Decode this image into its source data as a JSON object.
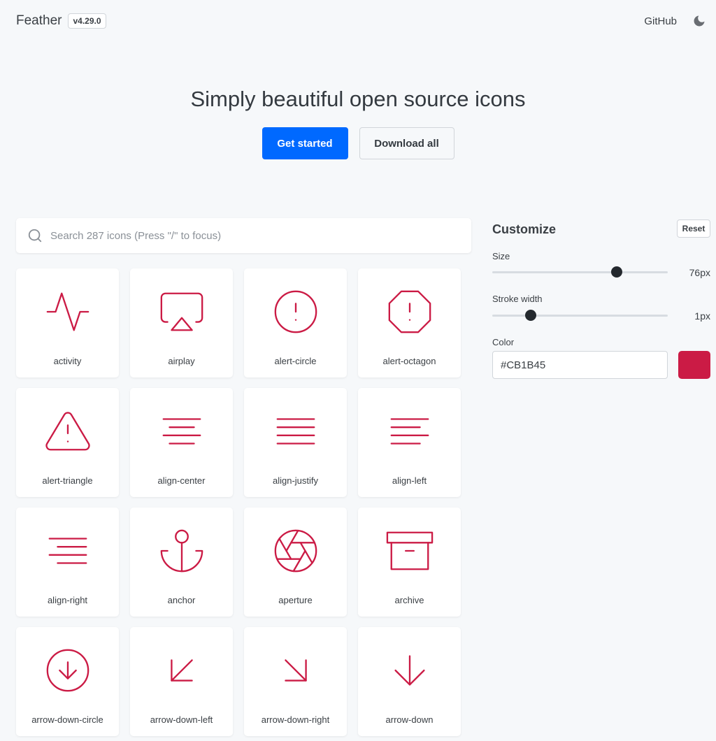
{
  "header": {
    "brand": "Feather",
    "version": "v4.29.0",
    "github_label": "GitHub",
    "theme_icon": "moon-icon"
  },
  "hero": {
    "title": "Simply beautiful open source icons",
    "primary_label": "Get started",
    "secondary_label": "Download all"
  },
  "search": {
    "placeholder": "Search 287 icons (Press \"/\" to focus)",
    "value": ""
  },
  "icons": [
    {
      "name": "activity"
    },
    {
      "name": "airplay"
    },
    {
      "name": "alert-circle"
    },
    {
      "name": "alert-octagon"
    },
    {
      "name": "alert-triangle"
    },
    {
      "name": "align-center"
    },
    {
      "name": "align-justify"
    },
    {
      "name": "align-left"
    },
    {
      "name": "align-right"
    },
    {
      "name": "anchor"
    },
    {
      "name": "aperture"
    },
    {
      "name": "archive"
    },
    {
      "name": "arrow-down-circle"
    },
    {
      "name": "arrow-down-left"
    },
    {
      "name": "arrow-down-right"
    },
    {
      "name": "arrow-down"
    }
  ],
  "customize": {
    "title": "Customize",
    "reset_label": "Reset",
    "size_label": "Size",
    "size_value": "76px",
    "size_slider_fraction": 0.71,
    "stroke_label": "Stroke width",
    "stroke_value": "1px",
    "stroke_slider_fraction": 0.22,
    "color_label": "Color",
    "color_value": "#CB1B45"
  },
  "colors": {
    "icon": "#CB1B45",
    "accent": "#0069ff"
  }
}
